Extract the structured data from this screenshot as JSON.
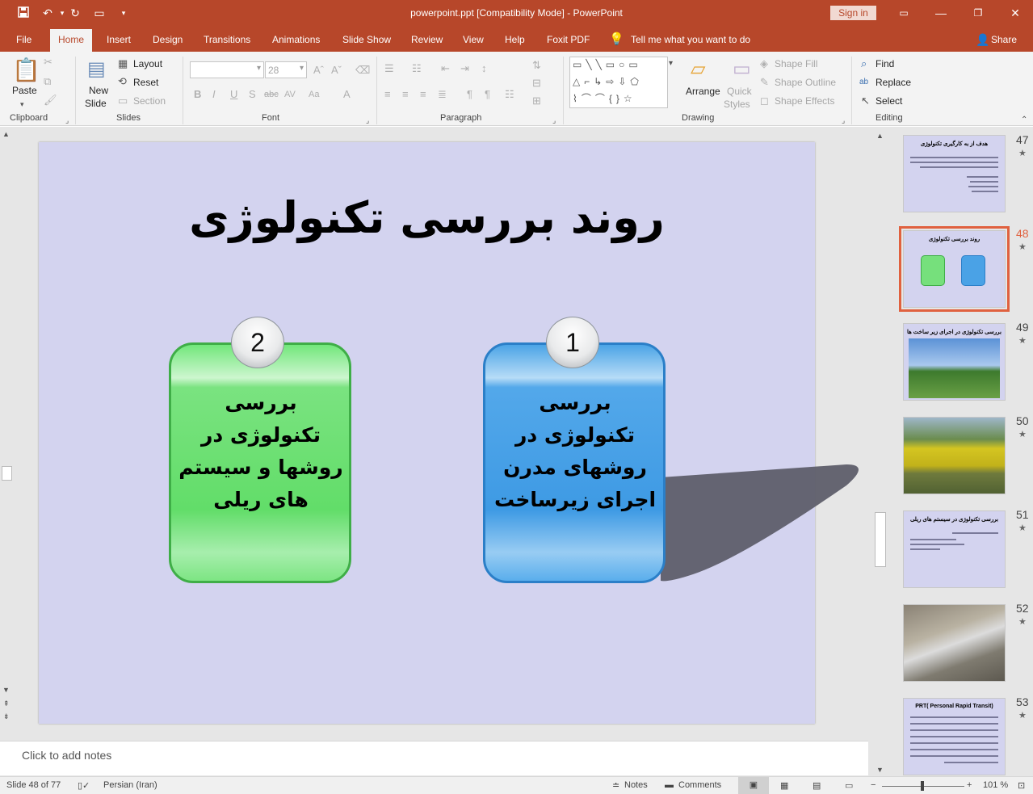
{
  "titlebar": {
    "title": "powerpoint.ppt [Compatibility Mode]  -  PowerPoint",
    "sign_in": "Sign in"
  },
  "tabs": [
    "File",
    "Home",
    "Insert",
    "Design",
    "Transitions",
    "Animations",
    "Slide Show",
    "Review",
    "View",
    "Help",
    "Foxit PDF"
  ],
  "tell_me": "Tell me what you want to do",
  "share": "Share",
  "ribbon": {
    "clipboard": {
      "label": "Clipboard",
      "paste": "Paste"
    },
    "slides": {
      "label": "Slides",
      "new_slide_1": "New",
      "new_slide_2": "Slide",
      "layout": "Layout",
      "reset": "Reset",
      "section": "Section"
    },
    "font": {
      "label": "Font",
      "size": "28"
    },
    "paragraph": {
      "label": "Paragraph"
    },
    "drawing": {
      "label": "Drawing",
      "arrange": "Arrange",
      "quick_styles_1": "Quick",
      "quick_styles_2": "Styles",
      "shape_fill": "Shape Fill",
      "shape_outline": "Shape Outline",
      "shape_effects": "Shape Effects"
    },
    "editing": {
      "label": "Editing",
      "find": "Find",
      "replace": "Replace",
      "select": "Select"
    }
  },
  "slide": {
    "title": "روند بررسی تکنولوژی",
    "cards": [
      {
        "number": "2",
        "text": "بررسی تکنولوژی در روشها و سیستم های ریلی",
        "color": "#62dd69"
      },
      {
        "number": "1",
        "text": "بررسی تکنولوژی در روشهای مدرن اجرای زیرساخت",
        "color": "#3e9ae4"
      }
    ]
  },
  "notes_placeholder": "Click to add notes",
  "thumbnails": [
    {
      "num": "47",
      "title": "هدف از به کارگیری تکنولوژی",
      "star": "★"
    },
    {
      "num": "48",
      "title": "روند بررسی تکنولوژی",
      "star": "★",
      "selected": true
    },
    {
      "num": "49",
      "title": "بررسی تکنولوژی در اجرای زیر ساخت ها",
      "star": "★"
    },
    {
      "num": "50",
      "title": "",
      "star": "★"
    },
    {
      "num": "51",
      "title": "بررسی تکنولوژی در سیستم های ریلی",
      "star": "★"
    },
    {
      "num": "52",
      "title": "",
      "star": "★"
    },
    {
      "num": "53",
      "title": "PRT( Personal Rapid Transit)",
      "star": "★"
    }
  ],
  "status": {
    "slide": "Slide 48 of 77",
    "language": "Persian (Iran)",
    "notes": "Notes",
    "comments": "Comments",
    "zoom": "101 %"
  }
}
